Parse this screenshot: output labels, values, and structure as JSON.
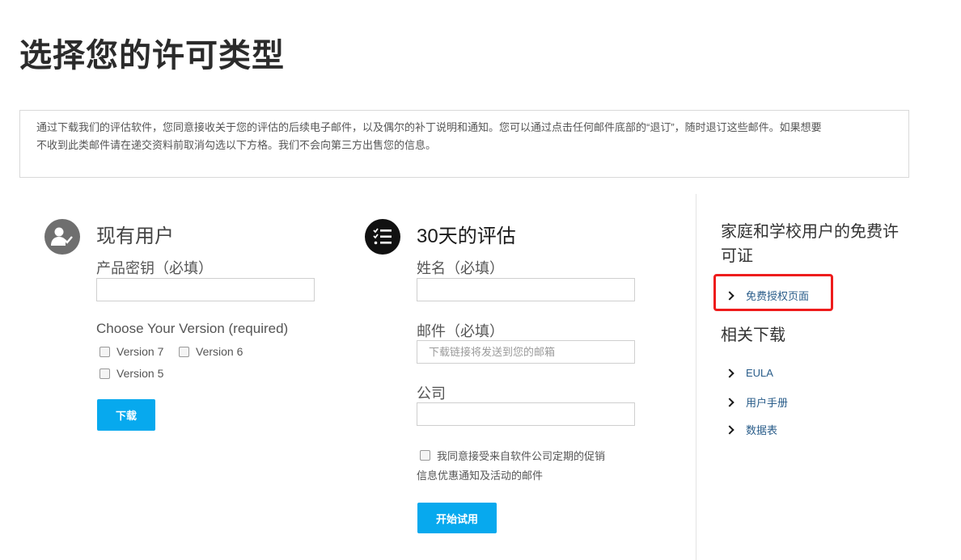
{
  "page": {
    "title": "选择您的许可类型",
    "notice_line1": "通过下载我们的评估软件，您同意接收关于您的评估的后续电子邮件，以及偶尔的补丁说明和通知。您可以通过点击任何邮件底部的“退订”，随时退订这些邮件。如果想要",
    "notice_line2": "不收到此类邮件请在递交资料前取消勾选以下方格。我们不会向第三方出售您的信息。"
  },
  "existing_user": {
    "title": "现有用户",
    "icon": "user-check-icon",
    "product_key_label": "产品密钥（必填）",
    "product_key_value": "",
    "version_label": "Choose Your Version (required)",
    "versions": [
      "Version 7",
      "Version 6",
      "Version 5"
    ],
    "download_button": "下载"
  },
  "trial": {
    "title": "30天的评估",
    "icon": "checklist-icon",
    "name_label": "姓名（必填）",
    "name_value": "",
    "email_label": "邮件（必填）",
    "email_placeholder": "下载链接将发送到您的邮箱",
    "company_label": "公司",
    "company_value": "",
    "consent_line1": "我同意接受来自软件公司定期的促销",
    "consent_line2": "信息优惠通知及活动的邮件",
    "start_button": "开始试用"
  },
  "sidebar": {
    "free_title_line1": "家庭和学校用户的免费许",
    "free_title_line2": "可证",
    "free_link": "免费授权页面",
    "downloads_title": "相关下载",
    "download_links": [
      "EULA",
      "用户手册",
      "数据表"
    ]
  },
  "colors": {
    "accent": "#07a9ee",
    "link": "#2a5d8a",
    "highlight": "#ee1c1c"
  }
}
